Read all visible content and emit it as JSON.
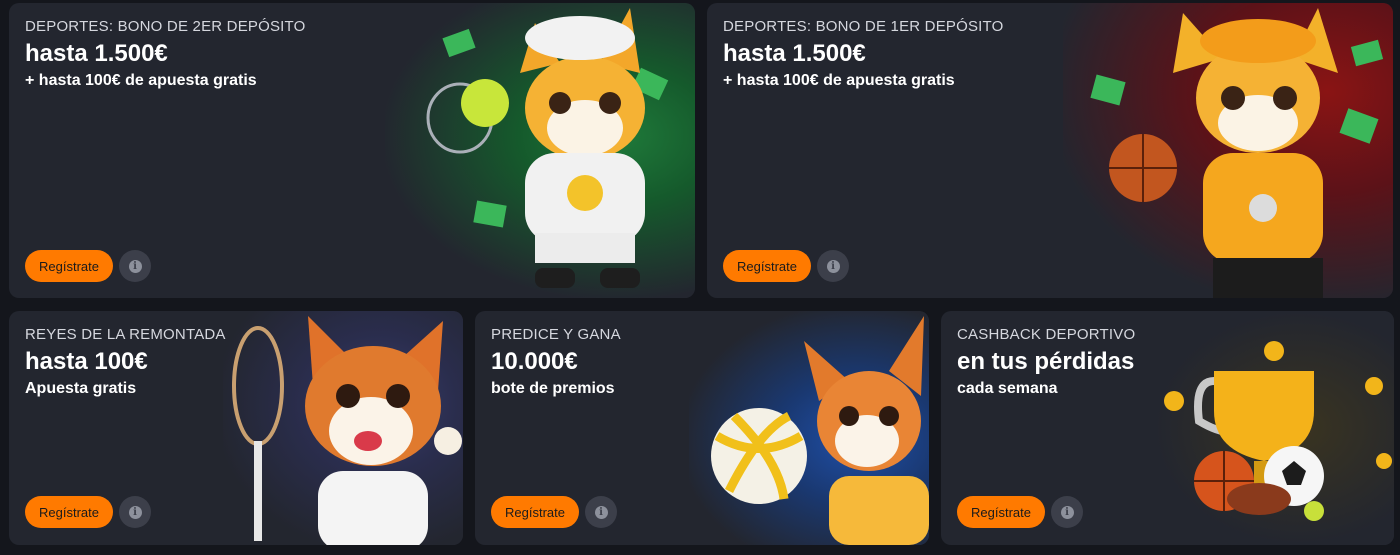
{
  "cards": [
    {
      "eyebrow": "DEPORTES: BONO DE 2ER DEPÓSITO",
      "headline": "hasta 1.500€",
      "sub": "+ hasta 100€ de apuesta gratis",
      "button": "Regístrate",
      "info_icon": "i",
      "art": "fox-tennis-mascot-illustration"
    },
    {
      "eyebrow": "DEPORTES: BONO DE 1ER DEPÓSITO",
      "headline": "hasta 1.500€",
      "sub": "+ hasta 100€ de apuesta gratis",
      "button": "Regístrate",
      "info_icon": "i",
      "art": "fox-basketball-mascot-illustration"
    },
    {
      "eyebrow": "REYES DE LA REMONTADA",
      "headline": "hasta 100€",
      "sub": "Apuesta gratis",
      "button": "Regístrate",
      "info_icon": "i",
      "art": "corgi-racket-mascot-illustration"
    },
    {
      "eyebrow": "PREDICE Y GANA",
      "headline": "10.000€",
      "sub": "bote de premios",
      "button": "Regístrate",
      "info_icon": "i",
      "art": "corgi-volleyball-mascot-illustration"
    },
    {
      "eyebrow": "CASHBACK DEPORTIVO",
      "headline": "en tus pérdidas",
      "sub": "cada semana",
      "button": "Regístrate",
      "info_icon": "i",
      "art": "trophy-balls-illustration"
    }
  ],
  "colors": {
    "page_bg": "#14161c",
    "card_bg": "#23262f",
    "accent": "#ff7a00",
    "text": "#ffffff",
    "muted": "#d5d7de"
  }
}
